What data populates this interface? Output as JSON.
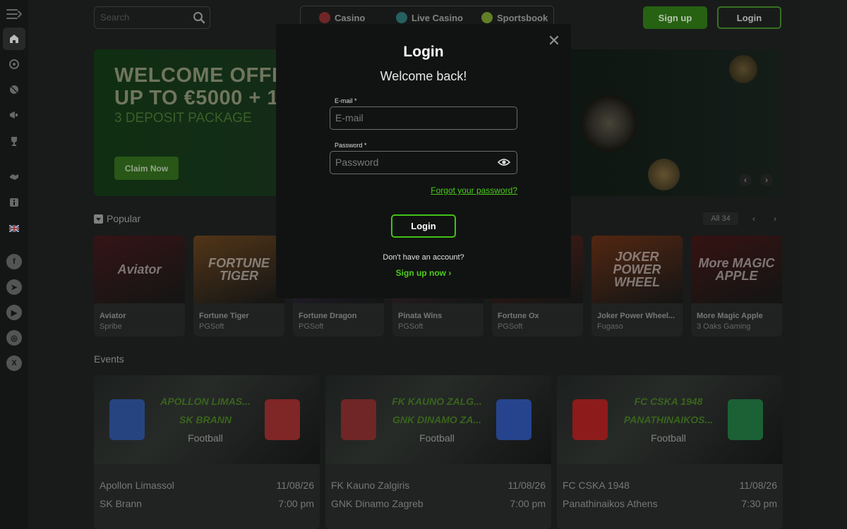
{
  "sidebar": {
    "menu_icon": "menu-arrow-icon",
    "items": [
      {
        "name": "home",
        "icon": "home-icon"
      },
      {
        "name": "casino",
        "icon": "chip-icon"
      },
      {
        "name": "sports",
        "icon": "ball-icon"
      },
      {
        "name": "promotions",
        "icon": "megaphone-icon"
      },
      {
        "name": "tournaments",
        "icon": "trophy-icon"
      },
      {
        "name": "vip",
        "icon": "handshake-icon"
      },
      {
        "name": "info",
        "icon": "info-icon"
      },
      {
        "name": "language",
        "icon": "uk-flag-icon"
      }
    ],
    "social": [
      {
        "name": "facebook",
        "glyph": "f"
      },
      {
        "name": "telegram",
        "glyph": "➤"
      },
      {
        "name": "youtube",
        "glyph": "▶"
      },
      {
        "name": "instagram",
        "glyph": "◎"
      },
      {
        "name": "x",
        "glyph": "X"
      }
    ]
  },
  "header": {
    "search_placeholder": "Search",
    "tabs": [
      {
        "label": "Casino",
        "color": "#8a2a2a"
      },
      {
        "label": "Live Casino",
        "color": "#2a6a6a"
      },
      {
        "label": "Sportsbook",
        "color": "#6a8a2a"
      }
    ],
    "signup_label": "Sign up",
    "login_label": "Login"
  },
  "banner": {
    "line1": "WELCOME OFFER",
    "line2": "UP TO €5000 + 150",
    "line3": "3 DEPOSIT PACKAGE",
    "cta": "Claim Now",
    "prev": "‹",
    "next": "›"
  },
  "popular": {
    "title": "Popular",
    "all_label": "All 34",
    "prev": "‹",
    "next": "›",
    "games": [
      {
        "name": "Aviator",
        "provider": "Spribe",
        "thumb_text": "Aviator",
        "bg": "#3a1618"
      },
      {
        "name": "Fortune Tiger",
        "provider": "PGSoft",
        "thumb_text": "FORTUNE TIGER",
        "bg": "#5a3a1a"
      },
      {
        "name": "Fortune Dragon",
        "provider": "PGSoft",
        "thumb_text": "",
        "bg": "#3a2a4a"
      },
      {
        "name": "Pinata Wins",
        "provider": "PGSoft",
        "thumb_text": "",
        "bg": "#4a2a3a"
      },
      {
        "name": "Fortune Ox",
        "provider": "PGSoft",
        "thumb_text": "",
        "bg": "#4a1e18"
      },
      {
        "name": "Joker Power Wheel...",
        "provider": "Fugaso",
        "thumb_text": "JOKER POWER WHEEL",
        "bg": "#5a2a14"
      },
      {
        "name": "More Magic Apple",
        "provider": "3 Oaks Gaming",
        "thumb_text": "More MAGIC APPLE",
        "bg": "#3a1414"
      }
    ]
  },
  "events": {
    "title": "Events",
    "items": [
      {
        "team1_short": "APOLLON LIMAS...",
        "team2_short": "SK BRANN",
        "sport": "Football",
        "team1": "Apollon Limassol",
        "team2": "SK Brann",
        "date": "11/08/26",
        "time": "7:00 pm",
        "badge1": "#2a4a8a",
        "badge2": "#8a2a2a"
      },
      {
        "team1_short": "FK KAUNO ZALG...",
        "team2_short": "GNK DINAMO ZA...",
        "sport": "Football",
        "team1": "FK Kauno Zalgiris",
        "team2": "GNK Dinamo Zagreb",
        "date": "11/08/26",
        "time": "7:00 pm",
        "badge1": "#7a2a2a",
        "badge2": "#2a4a9a"
      },
      {
        "team1_short": "FC CSKA 1948",
        "team2_short": "PANATHINAIKOS...",
        "sport": "Football",
        "team1": "FC CSKA 1948",
        "team2": "Panathinaikos Athens",
        "date": "11/08/26",
        "time": "7:30 pm",
        "badge1": "#9a1e1e",
        "badge2": "#1e6a3a"
      }
    ]
  },
  "modal": {
    "title": "Login",
    "subtitle": "Welcome back!",
    "email_label": "E-mail *",
    "email_placeholder": "E-mail",
    "email_value": "",
    "password_label": "Password *",
    "password_placeholder": "Password",
    "password_value": "",
    "forgot": "Forgot your password?",
    "submit": "Login",
    "no_account": "Don't have an account?",
    "signup_link": "Sign up now ›",
    "close": "✕"
  }
}
